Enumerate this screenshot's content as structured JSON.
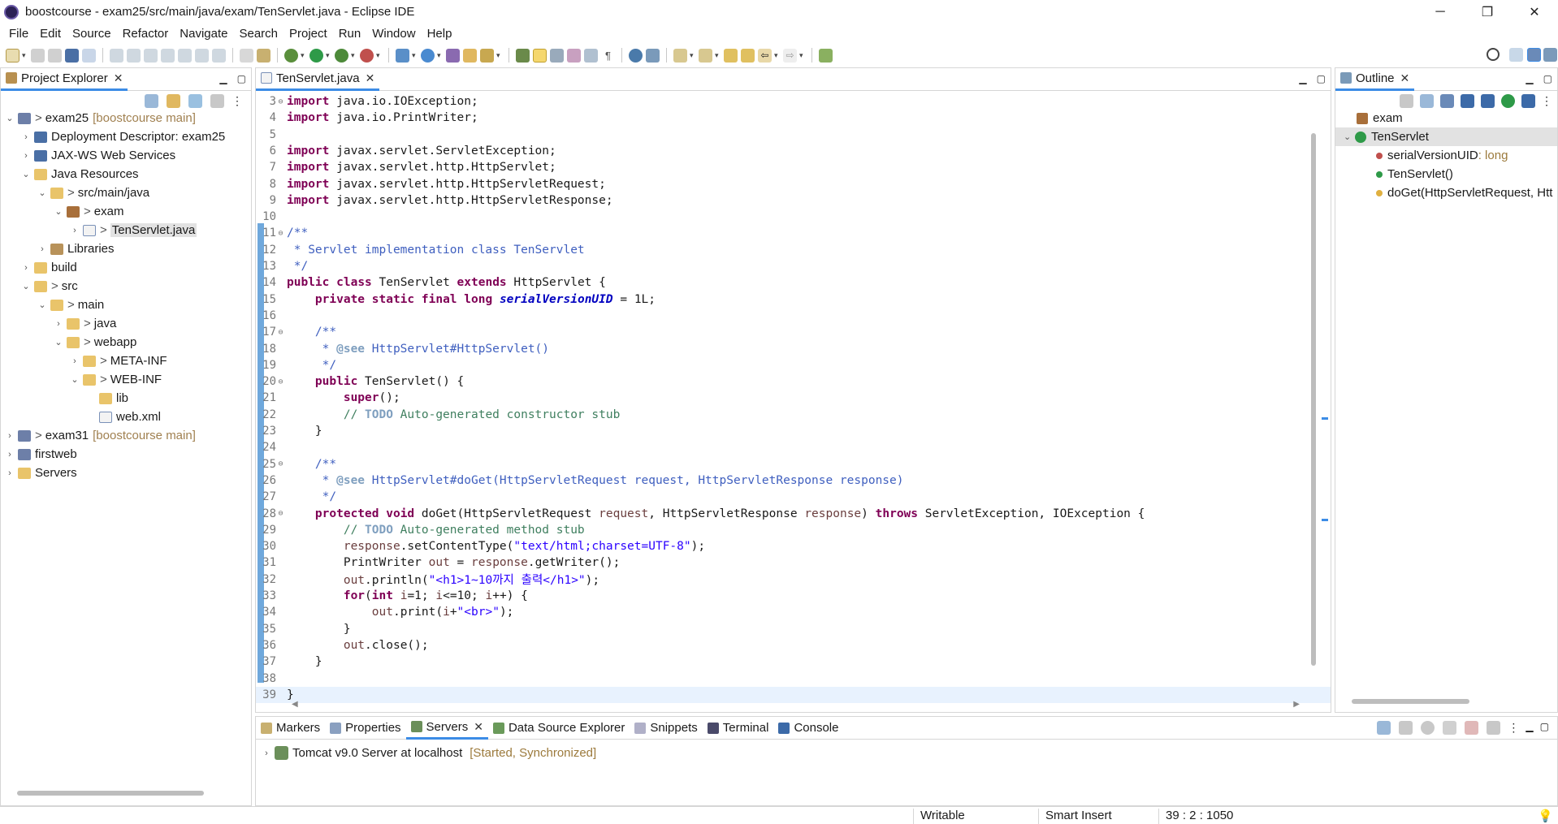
{
  "window": {
    "title": "boostcourse - exam25/src/main/java/exam/TenServlet.java - Eclipse IDE",
    "minimize": "─",
    "maximize": "❐",
    "close": "✕"
  },
  "menu": [
    "File",
    "Edit",
    "Source",
    "Refactor",
    "Navigate",
    "Search",
    "Project",
    "Run",
    "Window",
    "Help"
  ],
  "project_explorer": {
    "tab_label": "Project Explorer",
    "items": [
      {
        "label": "exam25",
        "decoration": "[boostcourse main]",
        "prefix": ">",
        "twisty": "⌄",
        "icon": "project-icon"
      },
      {
        "label": "Deployment Descriptor: exam25",
        "twisty": "›",
        "icon": "web-descriptor-icon"
      },
      {
        "label": "JAX-WS Web Services",
        "twisty": "›",
        "icon": "web-services-icon"
      },
      {
        "label": "Java Resources",
        "twisty": "⌄",
        "icon": "java-resources-icon"
      },
      {
        "label": "src/main/java",
        "prefix": ">",
        "twisty": "⌄",
        "icon": "source-folder-icon"
      },
      {
        "label": "exam",
        "prefix": ">",
        "twisty": "⌄",
        "icon": "package-icon"
      },
      {
        "label": "TenServlet.java",
        "prefix": ">",
        "twisty": "›",
        "icon": "java-file-icon"
      },
      {
        "label": "Libraries",
        "twisty": "›",
        "icon": "libraries-icon"
      },
      {
        "label": "build",
        "twisty": "›",
        "icon": "folder-icon"
      },
      {
        "label": "src",
        "prefix": ">",
        "twisty": "⌄",
        "icon": "folder-icon"
      },
      {
        "label": "main",
        "prefix": ">",
        "twisty": "⌄",
        "icon": "folder-icon"
      },
      {
        "label": "java",
        "prefix": ">",
        "twisty": "›",
        "icon": "folder-icon"
      },
      {
        "label": "webapp",
        "prefix": ">",
        "twisty": "⌄",
        "icon": "folder-icon"
      },
      {
        "label": "META-INF",
        "prefix": ">",
        "twisty": "›",
        "icon": "folder-icon"
      },
      {
        "label": "WEB-INF",
        "prefix": ">",
        "twisty": "⌄",
        "icon": "folder-icon"
      },
      {
        "label": "lib",
        "twisty": "",
        "icon": "folder-icon"
      },
      {
        "label": "web.xml",
        "twisty": "",
        "icon": "xml-file-icon"
      },
      {
        "label": "exam31",
        "decoration": "[boostcourse main]",
        "prefix": ">",
        "twisty": "›",
        "icon": "project-icon"
      },
      {
        "label": "firstweb",
        "twisty": "›",
        "icon": "project-icon"
      },
      {
        "label": "Servers",
        "twisty": "›",
        "icon": "folder-icon"
      }
    ]
  },
  "editor": {
    "tab_label": "TenServlet.java",
    "lines": [
      {
        "n": "3",
        "fold": "⊖",
        "text": "import java.io.IOException;"
      },
      {
        "n": "4",
        "text": "import java.io.PrintWriter;"
      },
      {
        "n": "5",
        "text": ""
      },
      {
        "n": "6",
        "text": "import javax.servlet.ServletException;"
      },
      {
        "n": "7",
        "text": "import javax.servlet.http.HttpServlet;"
      },
      {
        "n": "8",
        "text": "import javax.servlet.http.HttpServletRequest;"
      },
      {
        "n": "9",
        "text": "import javax.servlet.http.HttpServletResponse;"
      },
      {
        "n": "10",
        "text": ""
      },
      {
        "n": "11",
        "fold": "⊖",
        "text": "/**"
      },
      {
        "n": "12",
        "text": " * Servlet implementation class TenServlet"
      },
      {
        "n": "13",
        "text": " */"
      },
      {
        "n": "14",
        "text": "public class TenServlet extends HttpServlet {"
      },
      {
        "n": "15",
        "text": "    private static final long serialVersionUID = 1L;"
      },
      {
        "n": "16",
        "text": ""
      },
      {
        "n": "17",
        "fold": "⊖",
        "text": "    /**"
      },
      {
        "n": "18",
        "text": "     * @see HttpServlet#HttpServlet()"
      },
      {
        "n": "19",
        "text": "     */"
      },
      {
        "n": "20",
        "fold": "⊖",
        "text": "    public TenServlet() {"
      },
      {
        "n": "21",
        "text": "        super();"
      },
      {
        "n": "22",
        "text": "        // TODO Auto-generated constructor stub"
      },
      {
        "n": "23",
        "text": "    }"
      },
      {
        "n": "24",
        "text": ""
      },
      {
        "n": "25",
        "fold": "⊖",
        "text": "    /**"
      },
      {
        "n": "26",
        "text": "     * @see HttpServlet#doGet(HttpServletRequest request, HttpServletResponse response)"
      },
      {
        "n": "27",
        "text": "     */"
      },
      {
        "n": "28",
        "fold": "⊖",
        "text": "    protected void doGet(HttpServletRequest request, HttpServletResponse response) throws ServletException, IOException {"
      },
      {
        "n": "29",
        "text": "        // TODO Auto-generated method stub"
      },
      {
        "n": "30",
        "text": "        response.setContentType(\"text/html;charset=UTF-8\");"
      },
      {
        "n": "31",
        "text": "        PrintWriter out = response.getWriter();"
      },
      {
        "n": "32",
        "text": "        out.println(\"<h1>1~10까지 출력</h1>\");"
      },
      {
        "n": "33",
        "text": "        for(int i=1; i<=10; i++) {"
      },
      {
        "n": "34",
        "text": "            out.print(i+\"<br>\");"
      },
      {
        "n": "35",
        "text": "        }"
      },
      {
        "n": "36",
        "text": "        out.close();"
      },
      {
        "n": "37",
        "text": "    }"
      },
      {
        "n": "38",
        "text": ""
      },
      {
        "n": "39",
        "text": "}"
      }
    ]
  },
  "outline": {
    "tab_label": "Outline",
    "items": [
      {
        "label": "exam",
        "type": "",
        "icon": "package-icon"
      },
      {
        "label": "TenServlet",
        "type": "",
        "icon": "class-icon"
      },
      {
        "label": "serialVersionUID",
        "type": " : long",
        "icon": "field-icon"
      },
      {
        "label": "TenServlet()",
        "type": "",
        "icon": "constructor-icon"
      },
      {
        "label": "doGet(HttpServletRequest, Htt",
        "type": "",
        "icon": "method-icon"
      }
    ]
  },
  "bottom_tabs": [
    {
      "label": "Markers",
      "icon": "markers-icon"
    },
    {
      "label": "Properties",
      "icon": "properties-icon"
    },
    {
      "label": "Servers",
      "icon": "servers-icon",
      "active": true
    },
    {
      "label": "Data Source Explorer",
      "icon": "data-source-icon"
    },
    {
      "label": "Snippets",
      "icon": "snippets-icon"
    },
    {
      "label": "Terminal",
      "icon": "terminal-icon"
    },
    {
      "label": "Console",
      "icon": "console-icon"
    }
  ],
  "servers": {
    "name": "Tomcat v9.0 Server at localhost",
    "status": "[Started, Synchronized]"
  },
  "status_bar": {
    "writable": "Writable",
    "insert_mode": "Smart Insert",
    "position": "39 : 2 : 1050"
  },
  "colors": {
    "accent": "#3c8ce6",
    "keyword": "#7f0055",
    "comment": "#3f7f5f",
    "javadoc": "#3f5fbf",
    "string": "#2a00ff"
  }
}
